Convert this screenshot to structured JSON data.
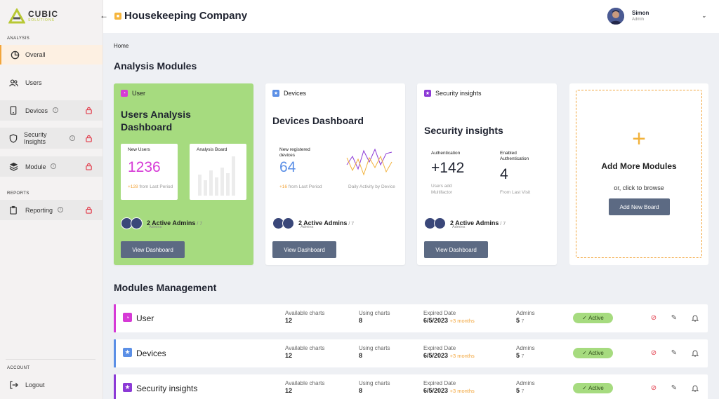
{
  "brand": {
    "name": "CUBIC",
    "sub": "SOLUTIONS"
  },
  "sidebar": {
    "sections": {
      "analysis": "ANALYSIS",
      "reports": "REPORTS",
      "account": "ACCOUNT"
    },
    "items": [
      {
        "label": "Overall"
      },
      {
        "label": "Users"
      },
      {
        "label": "Devices"
      },
      {
        "label": "Security Insights"
      },
      {
        "label": "Module"
      },
      {
        "label": "Reporting"
      }
    ],
    "logout": "Logout"
  },
  "header": {
    "title": "Housekeeping Company",
    "user_name": "Simon",
    "user_role": "Admin"
  },
  "breadcrumb": "Home",
  "analysis_title": "Analysis Modules",
  "cards": [
    {
      "tag": "User",
      "title": "Users Analysis Dashboard",
      "stat1": {
        "label": "New Users",
        "value": "1236",
        "delta": "+128",
        "note": " from Last Period"
      },
      "stat2": {
        "label": "Analysis Board"
      },
      "admins": "2 Active Admins",
      "admins_total": "/ 7",
      "admins_sub": "Admins",
      "button": "View Dashboard"
    },
    {
      "tag": "Devices",
      "title": "Devices Dashboard",
      "stat1": {
        "label": "New registered devices",
        "value": "64",
        "delta": "+16",
        "note": " from Last Period"
      },
      "stat2": {
        "label": "Daily Activity by Device"
      },
      "admins": "2 Active Admins",
      "admins_total": "/ 7",
      "admins_sub": "Admins",
      "button": "View Dashboard"
    },
    {
      "tag": "Security insights",
      "title": "Security insights",
      "stat1": {
        "label": "Authentication",
        "value": "+142",
        "note": "Users add Multifactor"
      },
      "stat2": {
        "label": "Enabled Authentication",
        "value": "4",
        "note": "From Last Visit"
      },
      "admins": "2 Active Admins",
      "admins_total": "/ 7",
      "admins_sub": "Admins",
      "button": "View Dashboard"
    }
  ],
  "add_card": {
    "plus": "+",
    "title": "Add More Modules",
    "sub": "or, click to browse",
    "button": "Add New Board"
  },
  "mgmt_title": "Modules Management",
  "mgmt_labels": {
    "available": "Available charts",
    "using": "Using charts",
    "expired": "Expired Date",
    "admins": "Admins"
  },
  "modules": [
    {
      "name": "User",
      "available": "12",
      "using": "8",
      "expired": "6/5/2023",
      "extra": "+3 months",
      "admins": "5",
      "admins_total": "7",
      "status": "Active"
    },
    {
      "name": "Devices",
      "available": "12",
      "using": "8",
      "expired": "6/5/2023",
      "extra": "+3 months",
      "admins": "5",
      "admins_total": "7",
      "status": "Active"
    },
    {
      "name": "Security insights",
      "available": "12",
      "using": "8",
      "expired": "6/5/2023",
      "extra": "+3 months",
      "admins": "5",
      "admins_total": "7",
      "status": "Active"
    }
  ],
  "colors": {
    "accent": "#f2a53b",
    "green": "#a6db7f",
    "button": "#5c6a83",
    "user": "#d63ad6",
    "devices": "#5b8fe6",
    "security": "#8c3ad6",
    "lock": "#e23b4a"
  }
}
